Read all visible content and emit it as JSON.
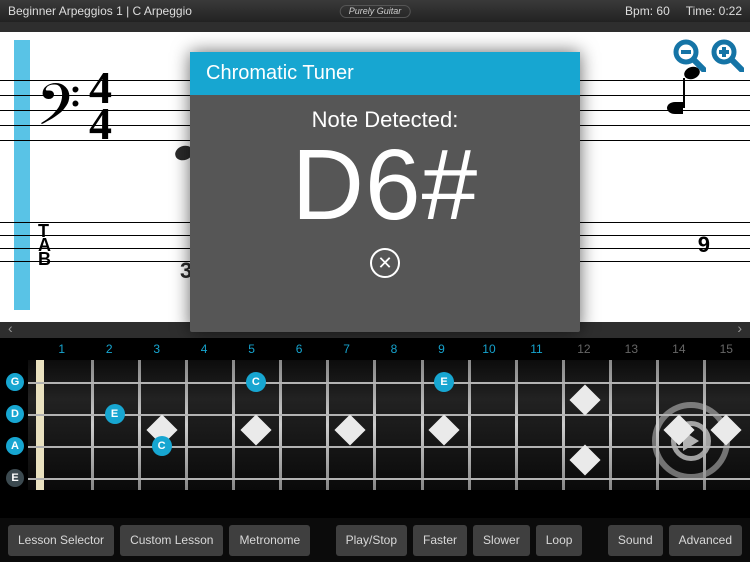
{
  "header": {
    "title": "Beginner Arpeggios 1 | C Arpeggio",
    "logo_text": "Purely Guitar",
    "bpm_label": "Bpm: 60",
    "time_label": "Time: 0:22"
  },
  "tuner": {
    "title": "Chromatic Tuner",
    "detected_label": "Note Detected:",
    "note": "D6#"
  },
  "score": {
    "time_top": "4",
    "time_bottom": "4",
    "tab_letter_t": "T",
    "tab_letter_a": "A",
    "tab_letter_b": "B",
    "tab_left_num": "3",
    "tab_right_num": "9"
  },
  "frets": {
    "numbers": [
      "1",
      "2",
      "3",
      "4",
      "5",
      "6",
      "7",
      "8",
      "9",
      "10",
      "11",
      "12",
      "13",
      "14",
      "15"
    ],
    "highlighted_frets": [
      1,
      2,
      3,
      4,
      5,
      6,
      7,
      8,
      9,
      10,
      11
    ],
    "open_strings": [
      "G",
      "D",
      "A",
      "E"
    ],
    "dim_string_index": 3,
    "notes": [
      {
        "fret": 2,
        "string": 1,
        "label": "E"
      },
      {
        "fret": 3,
        "string": 2,
        "label": "C"
      },
      {
        "fret": 5,
        "string": 0,
        "label": "C"
      },
      {
        "fret": 9,
        "string": 0,
        "label": "E"
      }
    ]
  },
  "toolbar": {
    "lesson_selector": "Lesson Selector",
    "custom_lesson": "Custom Lesson",
    "metronome": "Metronome",
    "play_stop": "Play/Stop",
    "faster": "Faster",
    "slower": "Slower",
    "loop": "Loop",
    "sound": "Sound",
    "advanced": "Advanced"
  },
  "nav": {
    "prev": "‹",
    "next": "›"
  }
}
